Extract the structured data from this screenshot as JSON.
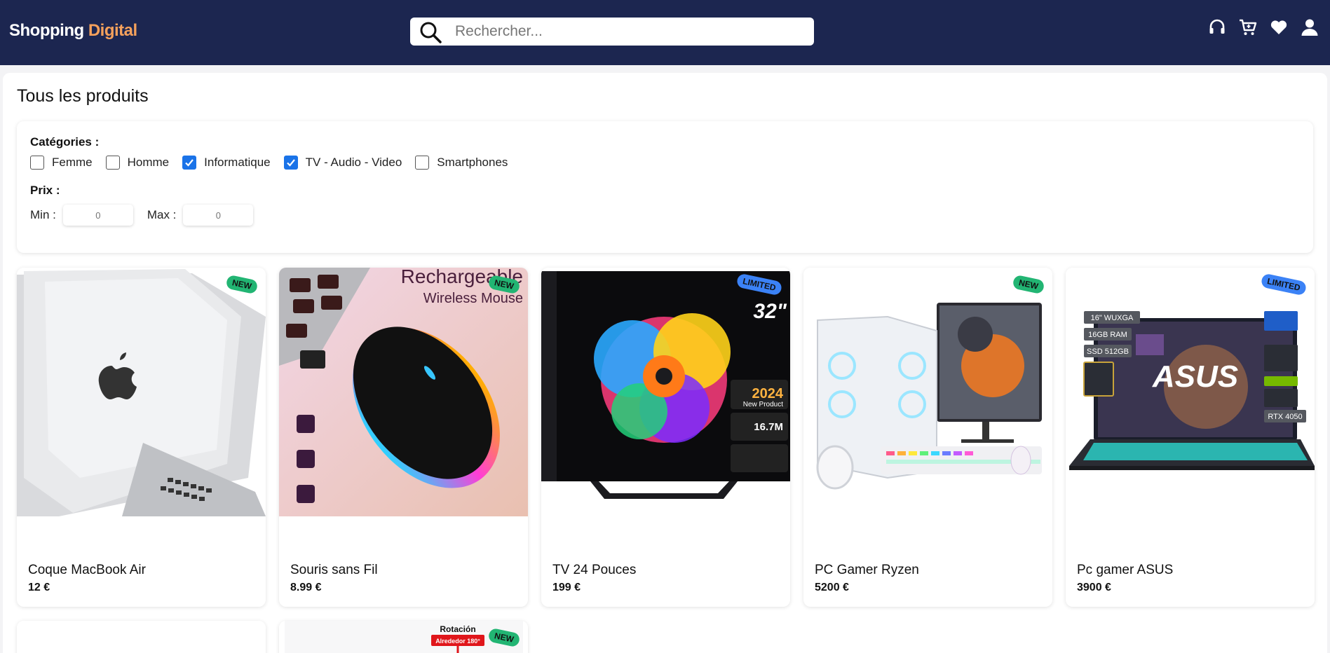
{
  "header": {
    "logo_main": "Shopping",
    "logo_accent": "Digital",
    "search_placeholder": "Rechercher...",
    "icons": [
      "headset-icon",
      "cart-icon",
      "heart-icon",
      "user-icon"
    ]
  },
  "page": {
    "title": "Tous les produits"
  },
  "filters": {
    "categories_label": "Catégories :",
    "categories": [
      {
        "label": "Femme",
        "checked": false
      },
      {
        "label": "Homme",
        "checked": false
      },
      {
        "label": "Informatique",
        "checked": true
      },
      {
        "label": "TV - Audio - Video",
        "checked": true
      },
      {
        "label": "Smartphones",
        "checked": false
      }
    ],
    "price_label": "Prix :",
    "min_label": "Min :",
    "max_label": "Max :",
    "min_value": "0",
    "max_value": "0"
  },
  "products": [
    {
      "name": "Coque MacBook Air",
      "price": "12 €",
      "badge": "NEW"
    },
    {
      "name": "Souris sans Fil",
      "price": "8.99 €",
      "badge": "NEW",
      "image_text_1": "Rechargeable",
      "image_text_2": "Wireless Mouse"
    },
    {
      "name": "TV 24 Pouces",
      "price": "199 €",
      "badge": "LIMITED",
      "image_text_1": "32\"",
      "image_text_2": "2024",
      "image_text_3": "New Product",
      "image_text_4": "16.7M"
    },
    {
      "name": "PC Gamer Ryzen",
      "price": "5200 €",
      "badge": "NEW"
    },
    {
      "name": "Pc gamer ASUS",
      "price": "3900 €",
      "badge": "LIMITED",
      "image_text_1": "ASUS",
      "image_text_2": "16\" WUXGA",
      "image_text_3": "16GB RAM",
      "image_text_4": "SSD 512GB",
      "image_text_5": "RTX 4050"
    }
  ],
  "next_row": [
    {
      "badge": "",
      "image_text_1": ""
    },
    {
      "badge": "NEW",
      "image_text_1": "Rotación",
      "image_text_2": "Alrededor 180°"
    }
  ],
  "colors": {
    "header_bg": "#1c2650",
    "logo_accent": "#f5a15c",
    "badge_new": "#22b573",
    "badge_limited": "#3b82f6",
    "checkbox_checked": "#1a73e8"
  }
}
